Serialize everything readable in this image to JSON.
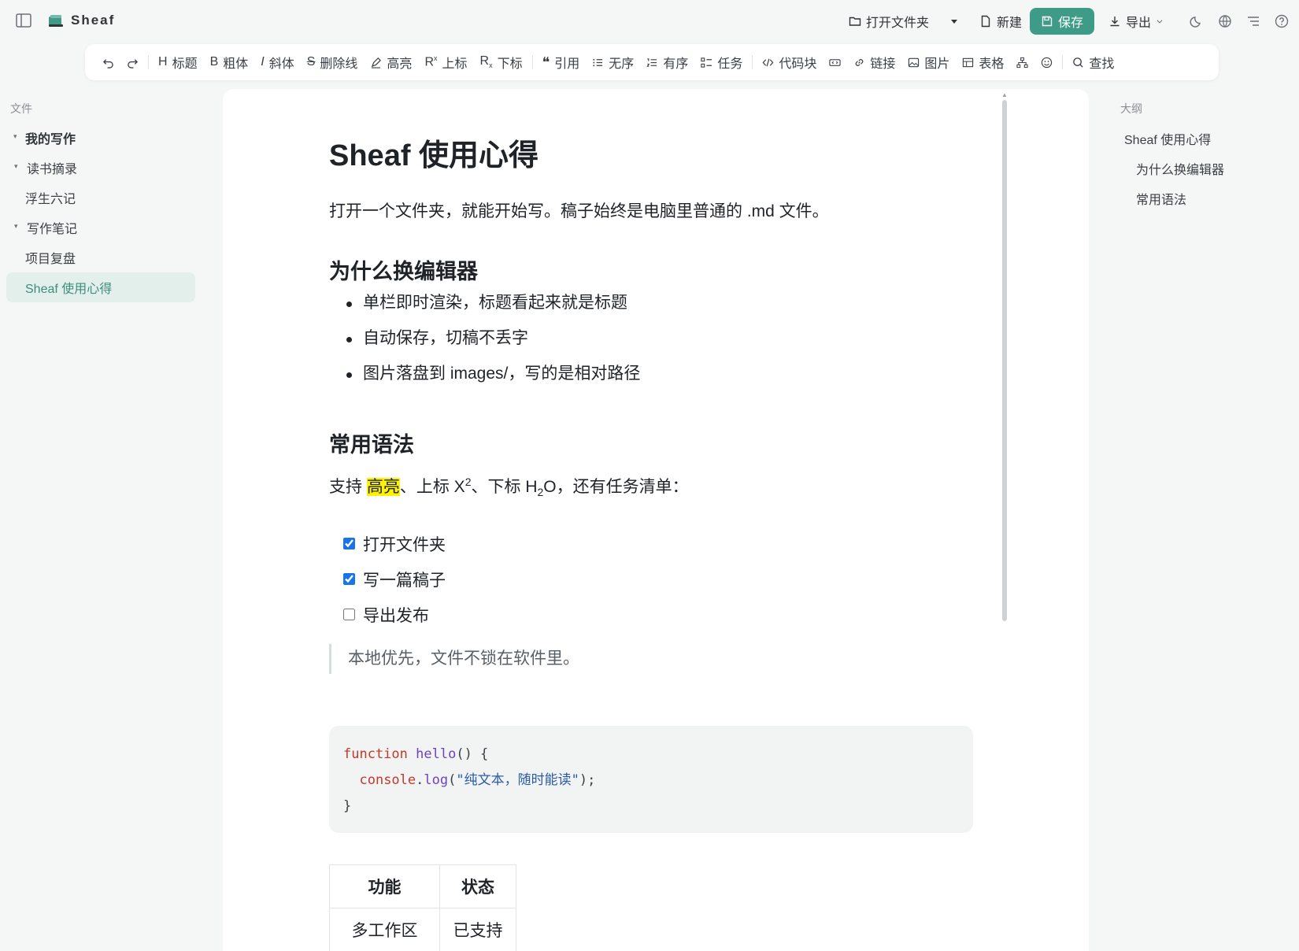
{
  "app": {
    "title": "Sheaf"
  },
  "topbar": {
    "open_folder": "打开文件夹",
    "new": "新建",
    "save": "保存",
    "export": "导出"
  },
  "toolbar": {
    "heading": "标题",
    "bold": "粗体",
    "italic": "斜体",
    "strike": "删除线",
    "highlight": "高亮",
    "superscript": "上标",
    "subscript": "下标",
    "quote": "引用",
    "unordered": "无序",
    "ordered": "有序",
    "task": "任务",
    "codeblock": "代码块",
    "link": "链接",
    "image": "图片",
    "table": "表格",
    "find": "查找"
  },
  "sidebar": {
    "label": "文件",
    "items": [
      {
        "label": "我的写作"
      },
      {
        "label": "读书摘录"
      },
      {
        "label": "浮生六记"
      },
      {
        "label": "写作笔记"
      },
      {
        "label": "项目复盘"
      },
      {
        "label": "Sheaf 使用心得"
      }
    ]
  },
  "doc": {
    "title": "Sheaf 使用心得",
    "intro": "打开一个文件夹，就能开始写。稿子始终是电脑里普通的 .md 文件。",
    "h2_why": "为什么换编辑器",
    "bullets": [
      "单栏即时渲染，标题看起来就是标题",
      "自动保存，切稿不丢字",
      "图片落盘到 images/，写的是相对路径"
    ],
    "h2_syntax": "常用语法",
    "syntax": {
      "prefix": "支持 ",
      "highlight": "高亮",
      "sup_text": "、上标 X",
      "sup": "2",
      "sub_text": "、下标 H",
      "sub": "2",
      "suffix": "O，还有任务清单："
    },
    "tasks": [
      {
        "label": "打开文件夹",
        "checked": true
      },
      {
        "label": "写一篇稿子",
        "checked": true
      },
      {
        "label": "导出发布",
        "checked": false
      }
    ],
    "quote": "本地优先，文件不锁在软件里。",
    "code": {
      "kw": "function",
      "fn": "hello",
      "rest1": "() {",
      "obj": "console",
      "dot": ".",
      "method": "log",
      "open": "(",
      "str": "\"纯文本，随时能读\"",
      "close": ");",
      "end": "}"
    },
    "table": {
      "headers": [
        "功能",
        "状态"
      ],
      "rows": [
        [
          "多工作区",
          "已支持"
        ]
      ]
    }
  },
  "outline": {
    "label": "大纲",
    "items": [
      {
        "label": "Sheaf 使用心得"
      },
      {
        "label": "为什么换编辑器"
      },
      {
        "label": "常用语法"
      }
    ]
  },
  "colors": {
    "accent": "#3d9b87",
    "active_bg": "#e2efeb",
    "highlight": "#fff200"
  }
}
